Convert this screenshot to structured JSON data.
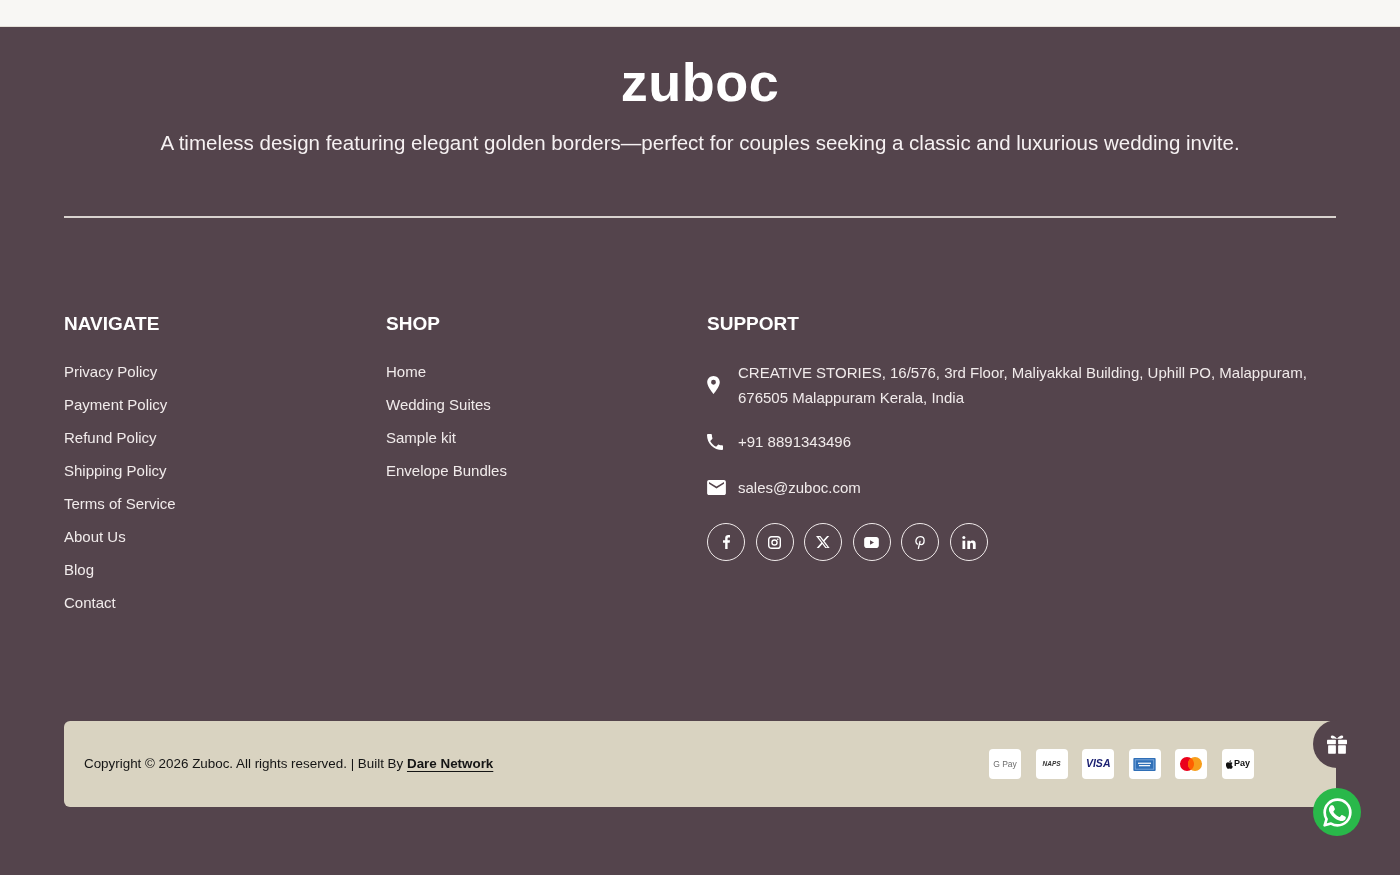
{
  "brand": {
    "logo": "zuboc",
    "tagline": "A timeless design featuring elegant golden borders—perfect for couples seeking a classic and luxurious wedding invite."
  },
  "columns": [
    {
      "kind": "links",
      "heading": "NAVIGATE",
      "links": [
        "Privacy Policy",
        "Payment Policy",
        "Refund Policy",
        "Shipping Policy",
        "Terms of Service",
        "About Us",
        "Blog",
        "Contact"
      ]
    },
    {
      "kind": "links",
      "heading": "SHOP",
      "links": [
        "Home",
        "Wedding Suites",
        "Sample kit",
        "Envelope Bundles"
      ]
    },
    {
      "kind": "contact",
      "heading": "SUPPORT",
      "contacts": [
        {
          "kind": "address",
          "text": "CREATIVE STORIES, 16/576, 3rd Floor, Maliyakkal Building, Uphill PO, Malappuram, 676505 Malappuram Kerala, India"
        },
        {
          "kind": "phone",
          "text": "+91 8891343496"
        },
        {
          "kind": "email",
          "text": "sales@zuboc.com"
        }
      ],
      "socials": [
        {
          "kind": "facebook"
        },
        {
          "kind": "instagram"
        },
        {
          "kind": "x"
        },
        {
          "kind": "youtube"
        },
        {
          "kind": "pinterest"
        },
        {
          "kind": "linkedin"
        }
      ]
    }
  ],
  "bottom_bar": {
    "copyright": "Copyright © 2026 Zuboc. All rights reserved. | Built By",
    "credit_link": "Dare Network",
    "payment_methods": [
      {
        "kind": "gpay",
        "label": "G Pay"
      },
      {
        "kind": "naps",
        "label": "NAPS"
      },
      {
        "kind": "visa",
        "label": "VISA"
      },
      {
        "kind": "amex"
      },
      {
        "kind": "mastercard"
      },
      {
        "kind": "applepay",
        "label": "Pay"
      }
    ]
  }
}
